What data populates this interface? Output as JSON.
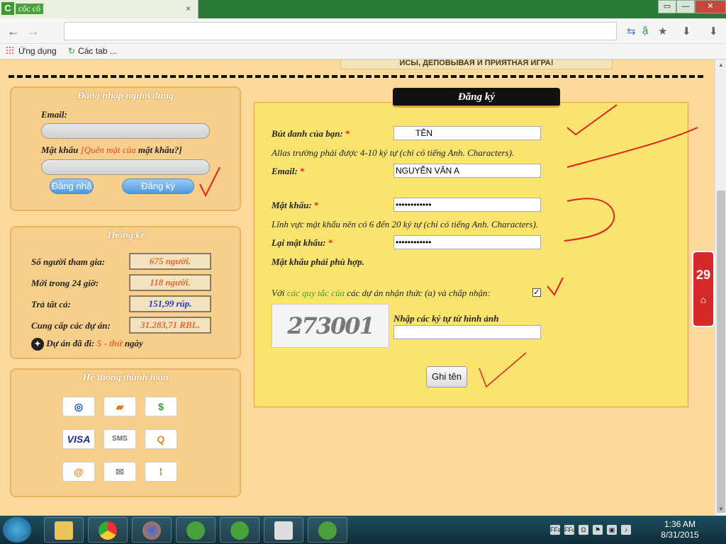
{
  "browser": {
    "tab_title": "cổc cổ",
    "tab_close": "×",
    "win_buttons": [
      "▭",
      "—",
      "✕"
    ],
    "back": "←",
    "forward": "→",
    "bookmarks": [
      "Ứng dụng",
      "Các tab ..."
    ]
  },
  "page": {
    "banner_text": "ЙСЫ, ДЕПОВЫВАЯ И ПРИЯТНАЯ ИГРА!",
    "login": {
      "title": "Đăng nhập người dùng",
      "email_label": "Email:",
      "password_label": "Mật khẩu",
      "forgot_link": "[Quên mật của",
      "forgot_link_tail": "mật khẩu?]",
      "login_button": "Đăng nhậ",
      "register_button": "Đăng ký"
    },
    "stats": {
      "title": "Thống kê",
      "rows": [
        {
          "label": "Số người tham gia:",
          "value": "675 người."
        },
        {
          "label": "Mới trong 24 giờ:",
          "value": "118 người."
        },
        {
          "label": "Trả tất cả:",
          "value": "151,99 rúp."
        },
        {
          "label": "Cung cấp các dự án:",
          "value": "31.283,71 RBL."
        }
      ],
      "project_prefix": "Dự án đã đi:",
      "project_days": "5 - thứ",
      "project_suffix": "ngày"
    },
    "payments": {
      "title": "Hệ thống thanh toán",
      "tiles": [
        "◎",
        "▰",
        "$",
        "VISA",
        "SMS",
        "Q",
        "@",
        "✉",
        "⁞"
      ]
    },
    "register": {
      "header": "Đăng ký",
      "nickname_label": "Bút danh của bạn:",
      "nickname_value": "TÊN",
      "alias_hint": "Allas trường phải được 4-10 ký tự (chỉ có tiếng Anh. Characters).",
      "email_label": "Email:",
      "email_value": "NGUYỄN VĂN A",
      "password_label": "Mật khẩu:",
      "password_value": "••••••••••••",
      "password_hint": "Lĩnh vực mật khẩu nên có 6 đến 20 ký tự (chỉ có tiếng Anh. Characters).",
      "confirm_label": "Lại mật khẩu:",
      "confirm_value": "••••••••••••",
      "confirm_hint": "Mật khẩu phải phù hợp.",
      "terms_prefix": "Với",
      "terms_link": "các quy tắc của",
      "terms_suffix": "các dự án nhận thức (a) và chấp nhận:",
      "terms_checked": "✓",
      "captcha_label": "Nhập các ký tự từ hình ảnh",
      "captcha_text": "273001",
      "submit": "Ghi tên",
      "required": "*"
    },
    "side_widget": "29"
  },
  "taskbar": {
    "time": "1:36 AM",
    "date": "8/31/2015",
    "tray_icons": [
      "FFa",
      "FFu",
      "Ω"
    ]
  },
  "colors": {
    "page_bg": "#fbd99a",
    "form_bg": "#fbe46e",
    "accent_orange": "#e06a2a",
    "required_red": "#e02020",
    "link_green": "#4a9a20"
  }
}
